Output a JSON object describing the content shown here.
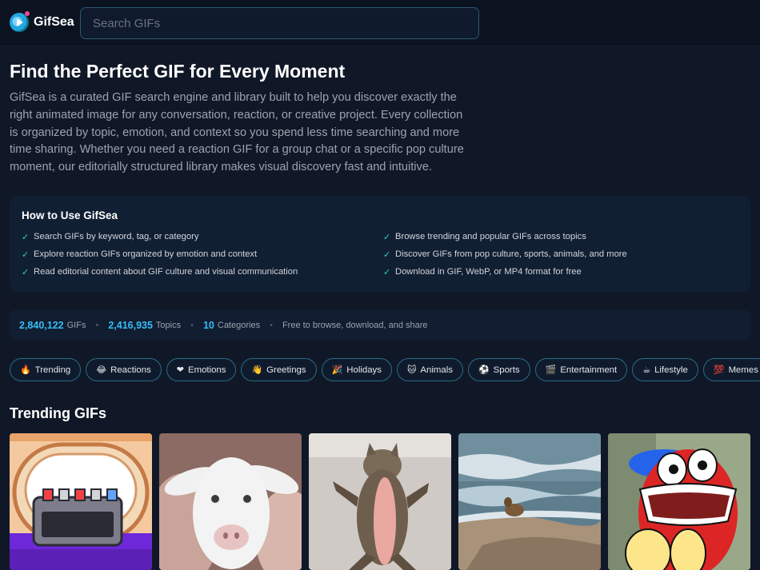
{
  "brand": {
    "name": "GifSea"
  },
  "search": {
    "placeholder": "Search GIFs"
  },
  "hero": {
    "title": "Find the Perfect GIF for Every Moment",
    "description": "GifSea is a curated GIF search engine and library built to help you discover exactly the right animated image for any conversation, reaction, or creative project. Every collection is organized by topic, emotion, and context so you spend less time searching and more time sharing. Whether you need a reaction GIF for a group chat or a specific pop culture moment, our editorially structured library makes visual discovery fast and intuitive."
  },
  "howto": {
    "title": "How to Use GifSea",
    "items": [
      "Search GIFs by keyword, tag, or category",
      "Browse trending and popular GIFs across topics",
      "Explore reaction GIFs organized by emotion and context",
      "Discover GIFs from pop culture, sports, animals, and more",
      "Read editorial content about GIF culture and visual communication",
      "Download in GIF, WebP, or MP4 format for free"
    ]
  },
  "stats": {
    "gifs_count": "2,840,122",
    "gifs_label": "GIFs",
    "topics_count": "2,416,935",
    "topics_label": "Topics",
    "categories_count": "10",
    "categories_label": "Categories",
    "note": "Free to browse, download, and share",
    "separator": "•"
  },
  "categories": [
    {
      "icon": "🔥",
      "label": "Trending"
    },
    {
      "icon": "😂",
      "label": "Reactions"
    },
    {
      "icon": "❤",
      "label": "Emotions"
    },
    {
      "icon": "👋",
      "label": "Greetings"
    },
    {
      "icon": "🎉",
      "label": "Holidays"
    },
    {
      "icon": "🐱",
      "label": "Animals"
    },
    {
      "icon": "⚽",
      "label": "Sports"
    },
    {
      "icon": "🎬",
      "label": "Entertainment"
    },
    {
      "icon": "☕",
      "label": "Lifestyle"
    },
    {
      "icon": "💯",
      "label": "Memes"
    }
  ],
  "trending": {
    "title": "Trending GIFs"
  },
  "colors": {
    "accent": "#38bdf8",
    "check": "#2dd4bf",
    "chip_border": "#2a6a85"
  }
}
